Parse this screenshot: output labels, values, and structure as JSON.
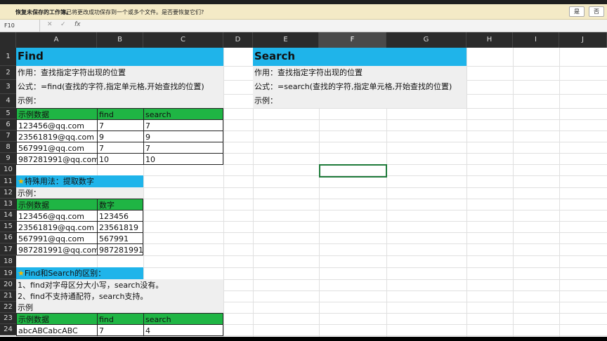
{
  "notice": {
    "title": "恢复未保存的工作簿。",
    "message": "已将更改成功保存到一个或多个文件。是否要恢复它们?",
    "yes_label": "是",
    "no_label": "否"
  },
  "formula_bar": {
    "cell_ref": "F10",
    "fx": "fx",
    "cancel": "✕",
    "confirm": "✓"
  },
  "columns": [
    "A",
    "B",
    "C",
    "D",
    "E",
    "F",
    "G",
    "H",
    "I",
    "J"
  ],
  "rows": [
    "1",
    "2",
    "3",
    "4",
    "5",
    "6",
    "7",
    "8",
    "9",
    "10",
    "11",
    "12",
    "13",
    "14",
    "15",
    "16",
    "17",
    "18",
    "19",
    "20",
    "21",
    "22",
    "23",
    "24"
  ],
  "find_block": {
    "title": "Find",
    "purpose": "作用：查找指定字符出现的位置",
    "formula": "公式：=find(查找的字符,指定单元格,开始查找的位置)",
    "example": "示例：",
    "headers": [
      "示例数据",
      "find",
      "search"
    ],
    "rows": [
      [
        "123456@qq.com",
        "7",
        "7"
      ],
      [
        "23561819@qq.com",
        "9",
        "9"
      ],
      [
        "567991@qq.com",
        "7",
        "7"
      ],
      [
        "987281991@qq.com",
        "10",
        "10"
      ]
    ]
  },
  "special_block": {
    "title": "特殊用法：提取数字",
    "example": "示例：",
    "headers": [
      "示例数据",
      "数字"
    ],
    "rows": [
      [
        "123456@qq.com",
        "123456"
      ],
      [
        "23561819@qq.com",
        "23561819"
      ],
      [
        "567991@qq.com",
        "567991"
      ],
      [
        "987281991@qq.com",
        "987281991"
      ]
    ]
  },
  "diff_block": {
    "title": "Find和Search的区别：",
    "line1": "1、find对字母区分大小写，search没有。",
    "line2": "2、find不支持通配符，search支持。",
    "example": "示例",
    "headers": [
      "示例数据",
      "find",
      "search"
    ],
    "rows": [
      [
        "abcABCabcABC",
        "7",
        "4"
      ]
    ]
  },
  "search_block": {
    "title": "Search",
    "purpose": "作用：查找指定字符出现的位置",
    "formula": "公式：=search(查找的字符,指定单元格,开始查找的位置)",
    "example": "示例："
  },
  "colors": {
    "header_blue": "#1fb4ea",
    "header_green": "#1fb544",
    "selection": "#1e7b3a"
  },
  "selected_cell": "F10"
}
